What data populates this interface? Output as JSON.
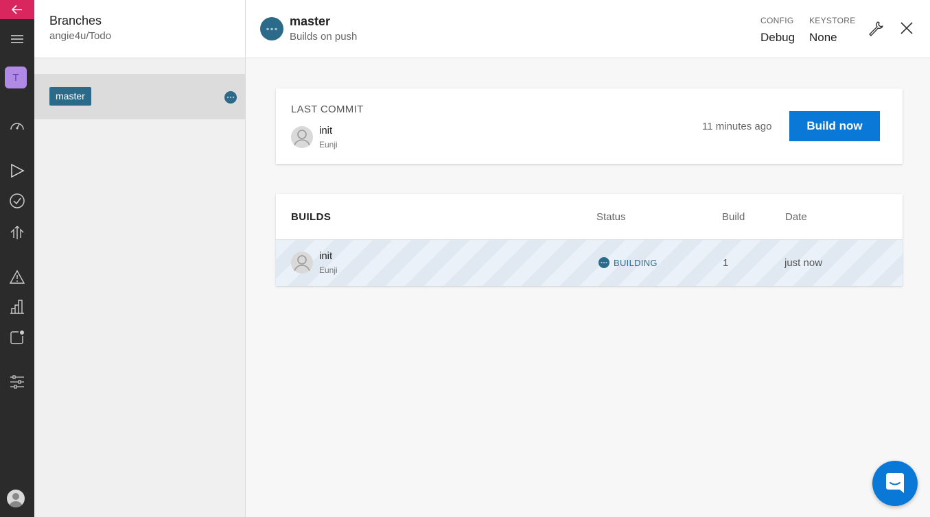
{
  "rail": {
    "app_initial": "T",
    "items": [
      "back-icon",
      "menu-icon",
      "dashboard-icon",
      "build-icon",
      "test-icon",
      "distribute-icon",
      "diagnostics-icon",
      "analytics-icon",
      "push-icon",
      "settings-icon",
      "user-icon"
    ]
  },
  "branches": {
    "title": "Branches",
    "repo": "angie4u/Todo",
    "items": [
      {
        "name": "master",
        "status": "building"
      }
    ]
  },
  "header": {
    "branch_name": "master",
    "trigger": "Builds on push",
    "config_label": "CONFIG",
    "config_value": "Debug",
    "keystore_label": "KEYSTORE",
    "keystore_value": "None"
  },
  "last_commit": {
    "label": "LAST COMMIT",
    "message": "init",
    "author": "Eunji",
    "time_ago": "11 minutes ago",
    "build_button": "Build now"
  },
  "builds": {
    "title": "BUILDS",
    "columns": {
      "status": "Status",
      "build": "Build",
      "date": "Date"
    },
    "rows": [
      {
        "message": "init",
        "author": "Eunji",
        "status": "BUILDING",
        "build": "1",
        "date": "just now"
      }
    ]
  },
  "colors": {
    "accent": "#0a78d7",
    "brand_pink": "#d9265f",
    "status_blue": "#2c6a8a"
  }
}
